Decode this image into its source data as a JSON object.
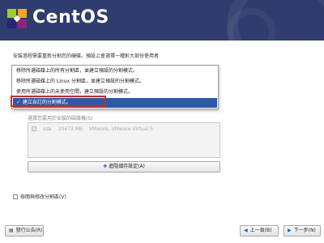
{
  "header": {
    "brand": "CentOS",
    "logo_icon": "centos-logo-icon",
    "bg_color": "#2f3c6e"
  },
  "intro_text": "安裝過程需要重新分割您的硬碟。預設上會選擇一種對大部份使用者",
  "partition_options": [
    {
      "label": "移除所選磁碟上的所有分割區，並建立預設的分割模式。",
      "selected": false
    },
    {
      "label": "移除所選磁碟上的 Linux 分割區，並建立預設的分割模式。",
      "selected": false
    },
    {
      "label": "使用所選磁碟上的未使用空間，建立預設的分割模式。",
      "selected": false
    },
    {
      "label": "建立自訂的分割模式。",
      "selected": true
    }
  ],
  "drive_section": {
    "label": "選擇您要用於安裝的磁碟機(S)",
    "drives": [
      {
        "checked": true,
        "name": "sda",
        "size": "20473 MB",
        "model": "VMware, VMware Virtual S"
      }
    ]
  },
  "storage_button": {
    "label": "進階儲存設定(A)",
    "icon": "plus-icon"
  },
  "review_checkbox": {
    "label": "檢閱與修改分割區(V)",
    "checked": false
  },
  "buttons": {
    "release_notes": "發行公告(R)",
    "back": "上一頁(B)",
    "next": "下一步(N)"
  },
  "accent_color": "#2d5aa6",
  "highlight_color": "#e2231a"
}
